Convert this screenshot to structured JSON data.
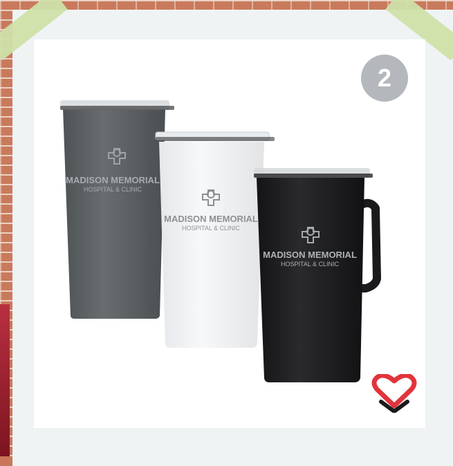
{
  "badge": {
    "number": "2"
  },
  "products": [
    {
      "color": "gray",
      "body": "#5d6266",
      "brand_line1": "MADISON MEMORIAL",
      "brand_line2": "HOSPITAL & CLINIC"
    },
    {
      "color": "white",
      "body": "#f1f2f4",
      "brand_line1": "MADISON MEMORIAL",
      "brand_line2": "HOSPITAL & CLINIC"
    },
    {
      "color": "black",
      "body": "#1c1c1e",
      "brand_line1": "MADISON MEMORIAL",
      "brand_line2": "HOSPITAL & CLINIC"
    }
  ],
  "icons": {
    "corner_logo": "heart-check-icon",
    "brand_logo": "heart-cross-icon"
  },
  "colors": {
    "frame": "#eff3f4",
    "tape": "#cfe0a8",
    "badge": "#b4b8bc",
    "heart": "#e2343c"
  }
}
